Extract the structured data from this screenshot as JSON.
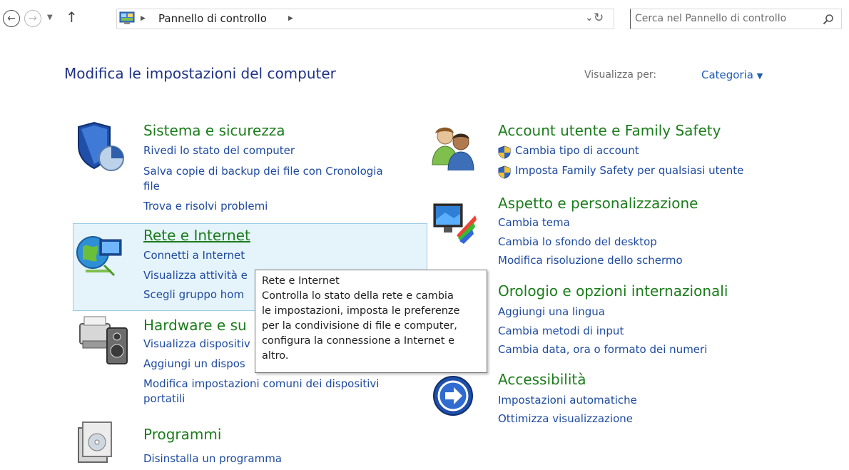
{
  "address_bar": {
    "breadcrumb": "Pannello di controllo",
    "search_placeholder": "Cerca nel Pannello di controllo"
  },
  "header": {
    "title": "Modifica le impostazioni del computer",
    "view_label": "Visualizza per:",
    "view_value": "Categoria"
  },
  "categories": {
    "sistema": {
      "title": "Sistema e sicurezza",
      "links": [
        "Rivedi lo stato del computer",
        "Salva copie di backup dei file con Cronologia",
        "file",
        "Trova e risolvi problemi"
      ]
    },
    "rete": {
      "title": "Rete e Internet",
      "links": [
        "Connetti a Internet",
        "Visualizza attività e",
        "Scegli gruppo hom"
      ]
    },
    "hardware": {
      "title": "Hardware e su",
      "links": [
        "Visualizza dispositiv",
        "Aggiungi un dispos",
        "Modifica impostazioni comuni dei dispositivi",
        "portatili"
      ]
    },
    "programmi": {
      "title": "Programmi",
      "links": [
        "Disinstalla un programma"
      ]
    },
    "account": {
      "title": "Account utente e Family Safety",
      "links": [
        "Cambia tipo di account",
        "Imposta Family Safety per qualsiasi utente"
      ]
    },
    "aspetto": {
      "title": "Aspetto e personalizzazione",
      "links": [
        "Cambia tema",
        "Cambia lo sfondo del desktop",
        "Modifica risoluzione dello schermo"
      ]
    },
    "orologio": {
      "title": "Orologio e opzioni internazionali",
      "links": [
        "Aggiungi una lingua",
        "Cambia metodi di input",
        "Cambia data, ora o formato dei numeri"
      ]
    },
    "accessibilita": {
      "title": "Accessibilità",
      "links": [
        "Impostazioni automatiche",
        "Ottimizza visualizzazione"
      ]
    }
  },
  "tooltip": {
    "lines": [
      "Rete e Internet",
      "Controlla lo stato della rete e cambia",
      "le impostazioni, imposta le preferenze",
      "per la condivisione di file e computer,",
      "configura la connessione a Internet e",
      "altro."
    ]
  },
  "icons": {
    "back": "back-arrow-icon",
    "forward": "forward-arrow-icon",
    "recent": "recent-pages-icon",
    "up": "up-arrow-icon",
    "control_panel": "control-panel-icon",
    "refresh": "refresh-icon",
    "search": "search-icon",
    "uac_shield": "uac-shield-icon"
  },
  "colors": {
    "category_title": "#1b7c1b",
    "link": "#1e4aa0",
    "page_title": "#1e3287",
    "hover_panel": "#e5f3fb"
  }
}
